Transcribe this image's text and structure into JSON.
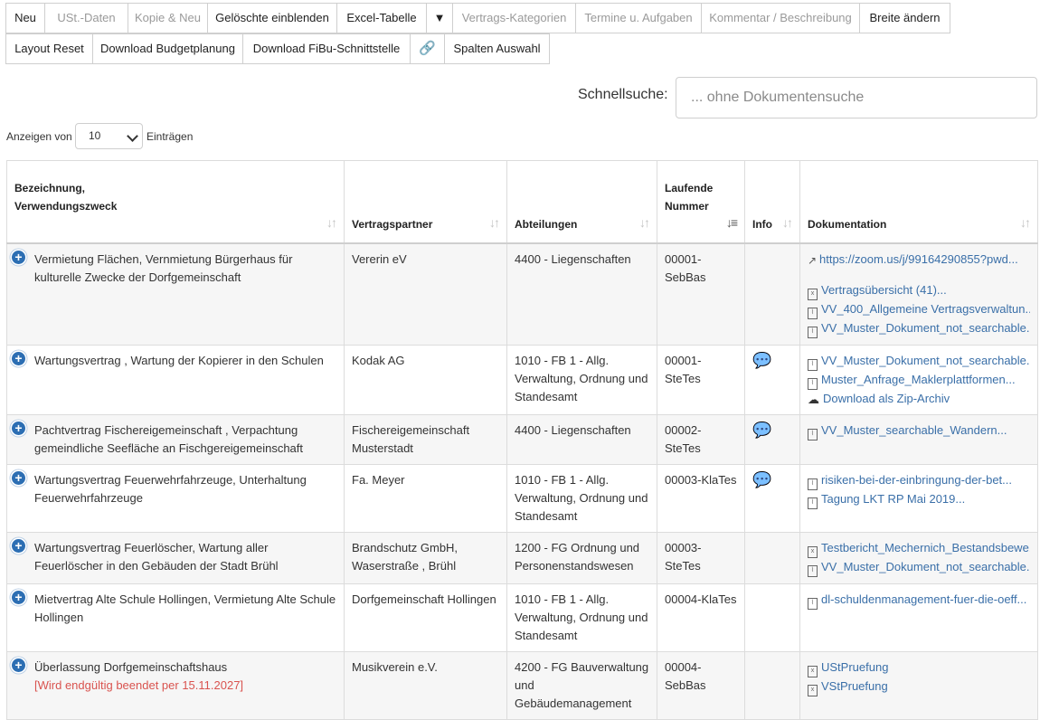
{
  "toolbar": {
    "row1": [
      {
        "label": "Neu",
        "disabled": false
      },
      {
        "label": "USt.-Daten",
        "disabled": true
      },
      {
        "label": "Kopie & Neu",
        "disabled": true
      },
      {
        "label": "Gelöschte einblenden",
        "disabled": false
      },
      {
        "label": "Excel-Tabelle",
        "disabled": false
      },
      {
        "label": "▼",
        "disabled": false
      },
      {
        "label": "Vertrags-Kategorien",
        "disabled": true
      },
      {
        "label": "Termine u. Aufgaben",
        "disabled": true
      },
      {
        "label": "Kommentar / Beschreibung",
        "disabled": true
      },
      {
        "label": "Breite ändern",
        "disabled": false
      }
    ],
    "row2": [
      {
        "label": "Layout Reset"
      },
      {
        "label": "Download Budgetplanung"
      },
      {
        "label": "Download FiBu-Schnittstelle"
      },
      {
        "label": "🔗"
      },
      {
        "label": "Spalten Auswahl"
      }
    ]
  },
  "search": {
    "label": "Schnellsuche:",
    "placeholder": "... ohne Dokumentensuche"
  },
  "page_length": {
    "prefix": "Anzeigen von",
    "value": "10",
    "suffix": "Einträgen"
  },
  "columns": [
    {
      "label": "Bezeichnung,\nVerwendungszweck"
    },
    {
      "label": "Vertragspartner"
    },
    {
      "label": "Abteilungen"
    },
    {
      "label": "Laufende\nNummer"
    },
    {
      "label": "Info"
    },
    {
      "label": "Dokumentation"
    }
  ],
  "rows": [
    {
      "bezeichnung": "Vermietung Flächen, Vernmietung Bürgerhaus für kulturelle Zwecke der Dorfgemeinschaft",
      "partner": "Vererin eV",
      "abteilung": "4400 - Liegenschaften",
      "nummer": "00001-SebBas",
      "info": false,
      "docs": [
        {
          "icon": "external-link-icon",
          "text": "https://zoom.us/j/99164290855?pwd..."
        },
        {
          "spacer": true
        },
        {
          "icon": "excel-file-icon",
          "text": "Vertragsübersicht (41)..."
        },
        {
          "icon": "pdf-file-icon",
          "text": "VV_400_Allgemeine Vertragsverwaltun..."
        },
        {
          "icon": "pdf-file-icon",
          "text": "VV_Muster_Dokument_not_searchable..."
        }
      ]
    },
    {
      "bezeichnung": "Wartungsvertrag , Wartung der Kopierer in den Schulen",
      "partner": "Kodak AG",
      "abteilung": "1010 - FB 1 - Allg. Verwaltung, Ordnung und Standesamt",
      "nummer": "00001-SteTes",
      "info": true,
      "docs": [
        {
          "icon": "pdf-file-icon",
          "text": "VV_Muster_Dokument_not_searchable..."
        },
        {
          "icon": "pdf-file-icon",
          "text": "Muster_Anfrage_Maklerplattformen..."
        },
        {
          "icon": "cloud-download-icon",
          "text": "Download als Zip-Archiv"
        }
      ]
    },
    {
      "bezeichnung": "Pachtvertrag Fischereigemeinschaft , Verpachtung gemeindliche Seefläche an Fischgereigemeinschaft",
      "partner": "Fischereigemeinschaft Musterstadt",
      "abteilung": "4400 - Liegenschaften",
      "nummer": "00002-SteTes",
      "info": true,
      "docs": [
        {
          "icon": "pdf-file-icon",
          "text": "VV_Muster_searchable_Wandern..."
        }
      ]
    },
    {
      "bezeichnung": "Wartungsvertrag Feuerwehrfahrzeuge, Unterhaltung Feuerwehrfahrzeuge",
      "partner": "Fa. Meyer",
      "abteilung": "1010 - FB 1 - Allg. Verwaltung, Ordnung und Standesamt",
      "nummer": "00003-KlaTes",
      "info": true,
      "docs": [
        {
          "icon": "pdf-file-icon",
          "text": "risiken-bei-der-einbringung-der-bet..."
        },
        {
          "icon": "pdf-file-icon",
          "text": "Tagung LKT RP Mai 2019..."
        }
      ]
    },
    {
      "bezeichnung": "Wartungsvertrag Feuerlöscher, Wartung aller Feuerlöscher in den Gebäuden der Stadt Brühl",
      "partner": "Brandschutz GmbH, Waserstraße , Brühl",
      "abteilung": "1200 - FG Ordnung und Personenstandswesen",
      "nummer": "00003-SteTes",
      "info": false,
      "docs": [
        {
          "icon": "excel-file-icon",
          "text": "Testbericht_Mechernich_Bestandsbewe..."
        },
        {
          "icon": "pdf-file-icon",
          "text": "VV_Muster_Dokument_not_searchable..."
        }
      ]
    },
    {
      "bezeichnung": "Mietvertrag Alte Schule Hollingen, Vermietung Alte Schule Hollingen",
      "partner": "Dorfgemeinschaft Hollingen",
      "abteilung": "1010 - FB 1 - Allg. Verwaltung, Ordnung und Standesamt",
      "nummer": "00004-KlaTes",
      "info": false,
      "docs": [
        {
          "icon": "pdf-file-icon",
          "text": "dl-schuldenmanagement-fuer-die-oeff..."
        }
      ]
    },
    {
      "bezeichnung": "Überlassung Dorfgemeinschaftshaus",
      "ended": "[Wird endgültig beendet per 15.11.2027]",
      "partner": "Musikverein e.V.",
      "abteilung": "4200 - FG Bauverwaltung und Gebäudemanagement",
      "nummer": "00004-SebBas",
      "info": false,
      "docs": [
        {
          "icon": "excel-file-icon",
          "text": "UStPruefung"
        },
        {
          "icon": "excel-file-icon",
          "text": "VStPruefung"
        }
      ]
    }
  ]
}
